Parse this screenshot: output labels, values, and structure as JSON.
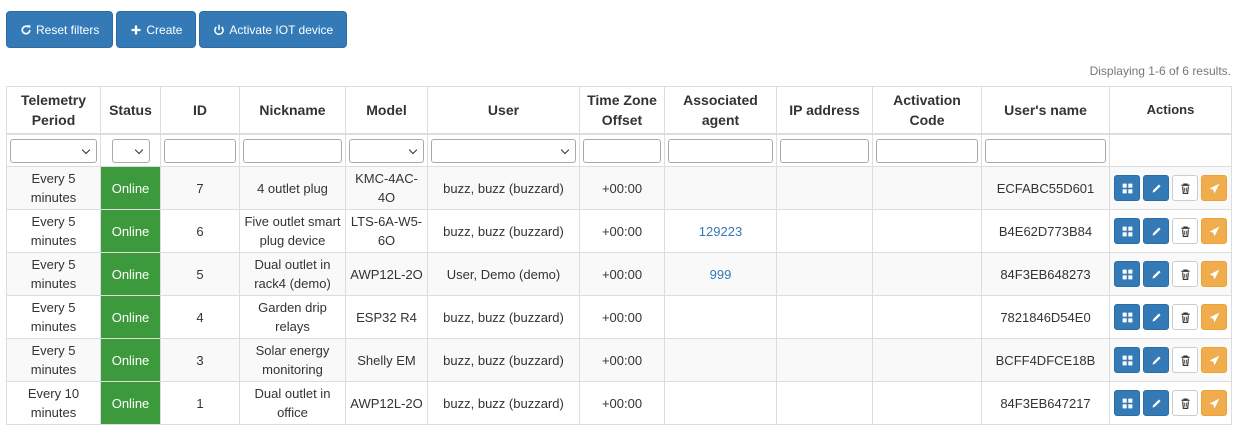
{
  "toolbar": {
    "reset_label": "Reset filters",
    "create_label": "Create",
    "activate_label": "Activate IOT device"
  },
  "summary": "Displaying 1-6 of 6 results.",
  "columns": {
    "telemetry": "Telemetry Period",
    "status": "Status",
    "id": "ID",
    "nickname": "Nickname",
    "model": "Model",
    "user": "User",
    "tz": "Time Zone Offset",
    "agent": "Associated agent",
    "ip": "IP address",
    "activation": "Activation Code",
    "username": "User's name",
    "actions": "Actions"
  },
  "rows": [
    {
      "telemetry": "Every 5 minutes",
      "status": "Online",
      "id": "7",
      "nickname": "4 outlet plug",
      "model": "KMC-4AC-4O",
      "user": "buzz, buzz (buzzard)",
      "tz": "+00:00",
      "agent": "",
      "ip": "",
      "activation": "",
      "username": "ECFABC55D601"
    },
    {
      "telemetry": "Every 5 minutes",
      "status": "Online",
      "id": "6",
      "nickname": "Five outlet smart plug device",
      "model": "LTS-6A-W5-6O",
      "user": "buzz, buzz (buzzard)",
      "tz": "+00:00",
      "agent": "129223",
      "ip": "",
      "activation": "",
      "username": "B4E62D773B84"
    },
    {
      "telemetry": "Every 5 minutes",
      "status": "Online",
      "id": "5",
      "nickname": "Dual outlet in rack4 (demo)",
      "model": "AWP12L-2O",
      "user": "User, Demo (demo)",
      "tz": "+00:00",
      "agent": "999",
      "ip": "",
      "activation": "",
      "username": "84F3EB648273"
    },
    {
      "telemetry": "Every 5 minutes",
      "status": "Online",
      "id": "4",
      "nickname": "Garden drip relays",
      "model": "ESP32 R4",
      "user": "buzz, buzz (buzzard)",
      "tz": "+00:00",
      "agent": "",
      "ip": "",
      "activation": "",
      "username": "7821846D54E0"
    },
    {
      "telemetry": "Every 5 minutes",
      "status": "Online",
      "id": "3",
      "nickname": "Solar energy monitoring",
      "model": "Shelly EM",
      "user": "buzz, buzz (buzzard)",
      "tz": "+00:00",
      "agent": "",
      "ip": "",
      "activation": "",
      "username": "BCFF4DFCE18B"
    },
    {
      "telemetry": "Every 10 minutes",
      "status": "Online",
      "id": "1",
      "nickname": "Dual outlet in office",
      "model": "AWP12L-2O",
      "user": "buzz, buzz (buzzard)",
      "tz": "+00:00",
      "agent": "",
      "ip": "",
      "activation": "",
      "username": "84F3EB647217"
    }
  ],
  "icons": {
    "reset": "refresh-icon",
    "create": "plus-icon",
    "activate": "power-icon",
    "view": "grid-icon",
    "edit": "pencil-icon",
    "delete": "trash-icon",
    "send": "send-icon"
  },
  "colors": {
    "primary": "#337ab7",
    "online": "#3c9a3c",
    "warning": "#f0ad4e",
    "link": "#337ab7"
  }
}
